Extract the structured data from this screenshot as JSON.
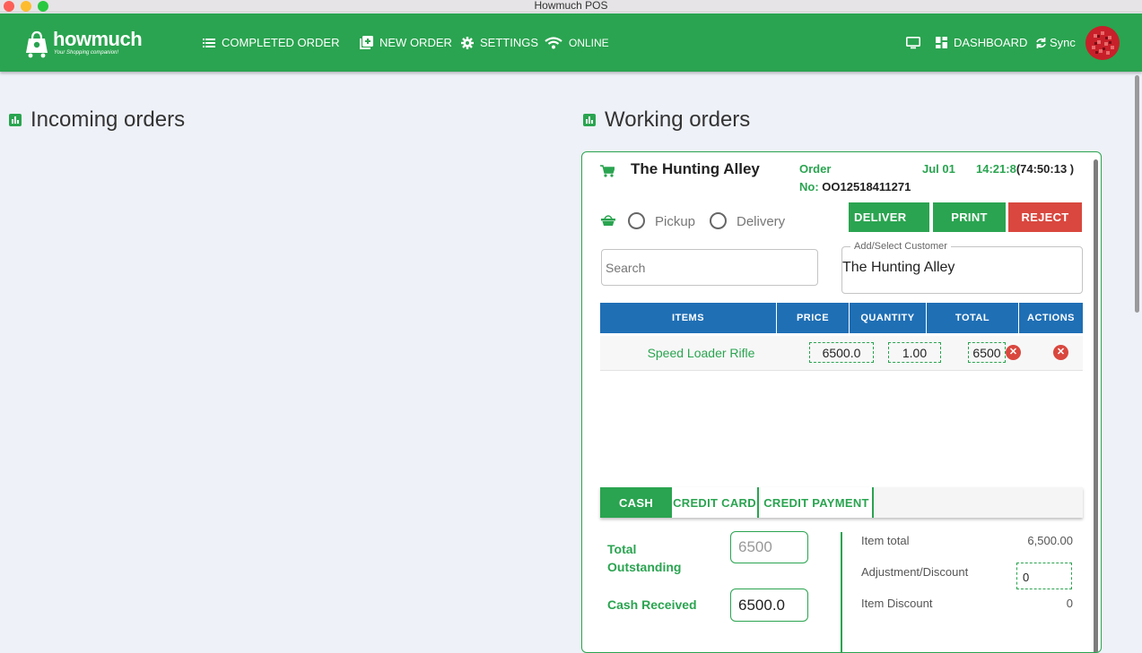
{
  "window": {
    "title": "Howmuch POS"
  },
  "brand": {
    "name": "howmuch",
    "tagline": "Your Shopping companion!"
  },
  "nav": {
    "completed_order": "COMPLETED ORDER",
    "new_order": "NEW ORDER",
    "settings": "SETTINGS",
    "online": "ONLINE",
    "dashboard": "DASHBOARD",
    "sync": "Sync"
  },
  "sections": {
    "incoming": "Incoming orders",
    "working": "Working orders"
  },
  "order": {
    "customer_name": "The Hunting Alley",
    "order_label": "Order",
    "order_no_label": "No:",
    "order_no": "OO12518411271",
    "date": "Jul 01",
    "time": "14:21:8",
    "elapsed": "(74:50:13 )",
    "pickup_label": "Pickup",
    "delivery_label": "Delivery",
    "deliver_button": "DELIVER",
    "print_button": "PRINT",
    "reject_button": "REJECT",
    "search_placeholder": "Search",
    "customer_field_label": "Add/Select Customer",
    "customer_field_value": "The Hunting Alley"
  },
  "table": {
    "headers": [
      "ITEMS",
      "PRICE",
      "QUANTITY",
      "TOTAL",
      "ACTIONS"
    ],
    "rows": [
      {
        "item": "Speed Loader Rifle",
        "price": "6500.0",
        "quantity": "1.00",
        "total": "6500"
      }
    ]
  },
  "payment": {
    "tabs": [
      "CASH",
      "CREDIT CARD",
      "CREDIT PAYMENT"
    ],
    "total_outstanding_label": "Total Outstanding",
    "total_outstanding_value": "6500",
    "cash_received_label": "Cash Received",
    "cash_received_value": "6500.0"
  },
  "summary": {
    "item_total_label": "Item total",
    "item_total_value": "6,500.00",
    "adjustment_label": "Adjustment/Discount",
    "adjustment_value": "0",
    "item_discount_label": "Item Discount",
    "item_discount_value": "0"
  },
  "colors": {
    "primary_green": "#2aa450",
    "header_blue": "#1f6fb5",
    "reject_red": "#d9473e"
  }
}
